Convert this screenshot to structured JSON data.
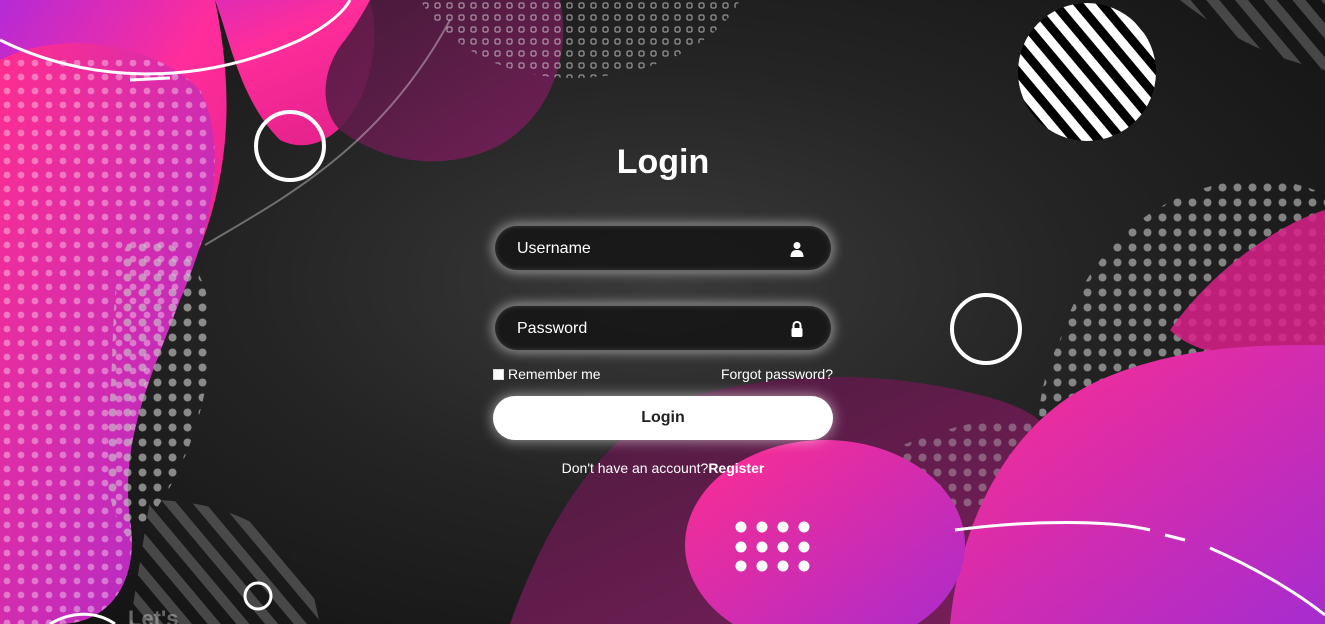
{
  "login": {
    "title": "Login",
    "username_placeholder": "Username",
    "password_placeholder": "Password",
    "remember_label": "Remember me",
    "forgot_label": "Forgot password?",
    "button_label": "Login",
    "register_prompt": "Don't have an account?",
    "register_label": "Register"
  },
  "background": {
    "corner_text": "Let's"
  },
  "colors": {
    "accent_pink": "#ff2d8f",
    "accent_purple": "#a62ccf",
    "background": "#242424",
    "button_bg": "#ffffff"
  },
  "icons": {
    "username": "user-icon",
    "password": "lock-icon"
  }
}
